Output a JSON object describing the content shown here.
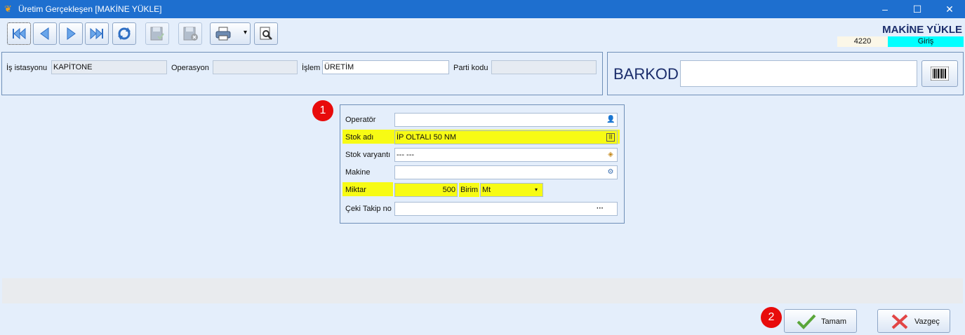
{
  "window": {
    "title": "Üretim Gerçekleşen [MAKİNE YÜKLE]",
    "minimize": "–",
    "maximize": "☐",
    "close": "✕"
  },
  "header": {
    "mode_title": "MAKİNE YÜKLE",
    "code": "4220",
    "status": "Giriş"
  },
  "toolbar": {
    "print_dropdown": "▾"
  },
  "info": {
    "istasyon_label": "İş istasyonu",
    "istasyon_value": "KAPİTONE",
    "operasyon_label": "Operasyon",
    "operasyon_value": "",
    "islem_label": "İşlem",
    "islem_value": "ÜRETİM",
    "parti_label": "Parti kodu",
    "parti_value": ""
  },
  "barcode": {
    "label": "BARKOD",
    "value": ""
  },
  "form": {
    "operator_label": "Operatör",
    "operator_value": "",
    "stok_adi_label": "Stok adı",
    "stok_adi_value": "İP OLTALI 50 NM",
    "stok_varyant_label": "Stok varyantı",
    "stok_varyant_value": "--- ---",
    "makine_label": "Makine",
    "makine_value": "",
    "miktar_label": "Miktar",
    "miktar_value": "500",
    "birim_label": "Birim",
    "birim_value": "Mt",
    "ceki_label": "Çeki Takip no",
    "ceki_value": "",
    "ceki_btn": "···"
  },
  "badges": {
    "one": "1",
    "two": "2"
  },
  "buttons": {
    "ok": "Tamam",
    "cancel": "Vazgeç"
  },
  "colors": {
    "titlebar": "#1e6fcf",
    "highlight": "#f7fb14",
    "status_cyan": "#00ffff",
    "badge_red": "#e80b0b"
  }
}
